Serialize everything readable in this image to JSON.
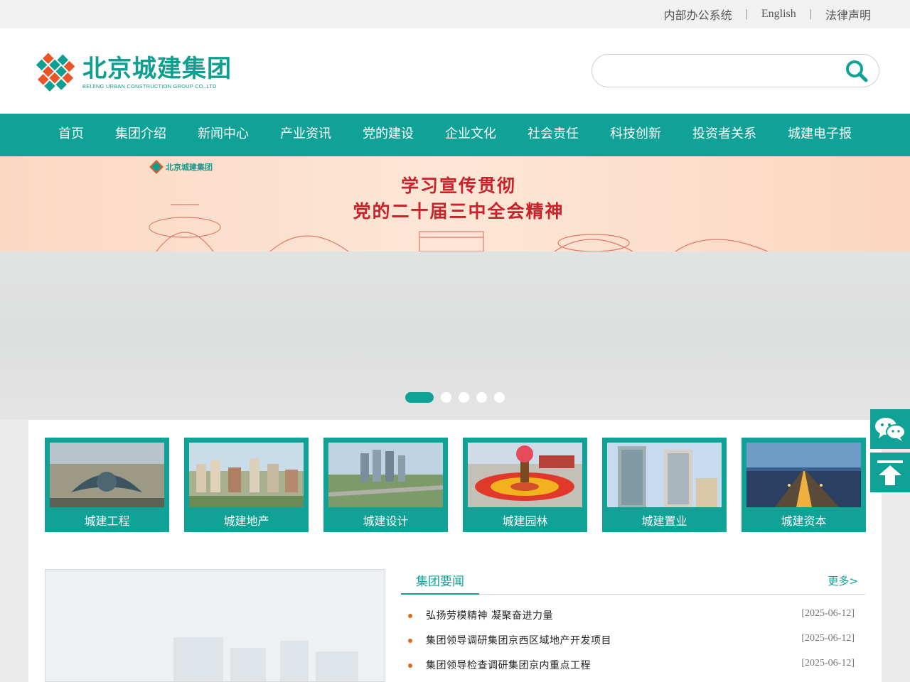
{
  "topbar": {
    "links": [
      "内部办公系统",
      "English",
      "法律声明"
    ],
    "separator": "|"
  },
  "logo": {
    "cn": "北京城建集团",
    "en": "BEIJING URBAN CONSTRUCTION GROUP CO.,LTD"
  },
  "search": {
    "placeholder": "",
    "value": ""
  },
  "nav": {
    "items": [
      "首页",
      "集团介绍",
      "新闻中心",
      "产业资讯",
      "党的建设",
      "企业文化",
      "社会责任",
      "科技创新",
      "投资者关系",
      "城建电子报"
    ]
  },
  "banner": {
    "logo_text": "北京城建集团",
    "line1": "学习宣传贯彻",
    "line2": "党的二十届三中全会精神"
  },
  "slider": {
    "count": 5,
    "active": 1
  },
  "tiles": [
    {
      "label": "城建工程",
      "icon": "airport-photo"
    },
    {
      "label": "城建地产",
      "icon": "residential-photo"
    },
    {
      "label": "城建设计",
      "icon": "city-design-photo"
    },
    {
      "label": "城建园林",
      "icon": "flower-basket-photo"
    },
    {
      "label": "城建置业",
      "icon": "office-tower-photo"
    },
    {
      "label": "城建资本",
      "icon": "bridge-night-photo"
    }
  ],
  "news": {
    "title": "集团要闻",
    "more": "更多>",
    "items": [
      {
        "title": "弘扬劳模精神 凝聚奋进力量",
        "date": "[2025-06-12]"
      },
      {
        "title": "集团领导调研集团京西区域地产开发项目",
        "date": "[2025-06-12]"
      },
      {
        "title": "集团领导检查调研集团京内重点工程",
        "date": "[2025-06-12]"
      }
    ]
  },
  "colors": {
    "brand": "#10a296",
    "accent_red": "#c8222a",
    "bullet": "#e36a1a"
  },
  "float": [
    "wechat-icon",
    "back-to-top-icon"
  ]
}
